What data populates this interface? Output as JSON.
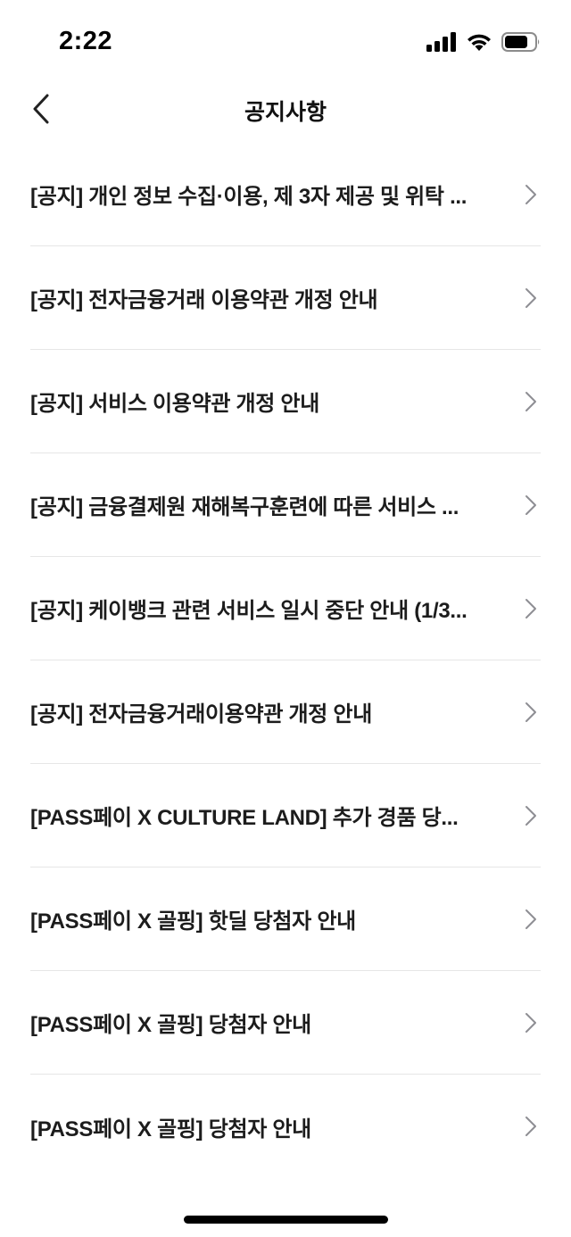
{
  "status_bar": {
    "time": "2:22"
  },
  "nav": {
    "title": "공지사항"
  },
  "notices": [
    {
      "title": "[공지] 개인 정보 수집·이용, 제 3자 제공 및 위탁 ..."
    },
    {
      "title": "[공지] 전자금융거래 이용약관 개정 안내"
    },
    {
      "title": "[공지] 서비스 이용약관 개정 안내"
    },
    {
      "title": "[공지] 금융결제원 재해복구훈련에 따른 서비스 ..."
    },
    {
      "title": "[공지] 케이뱅크 관련 서비스 일시 중단 안내 (1/3..."
    },
    {
      "title": "[공지] 전자금융거래이용약관 개정 안내"
    },
    {
      "title": "[PASS페이 X CULTURE LAND] 추가 경품 당..."
    },
    {
      "title": "[PASS페이 X 골핑] 핫딜 당첨자 안내"
    },
    {
      "title": "[PASS페이 X 골핑] 당첨자 안내"
    },
    {
      "title": "[PASS페이 X 골핑] 당첨자 안내"
    }
  ],
  "icons": {
    "back": "chevron-left-icon",
    "row_arrow": "chevron-right-icon",
    "signal": "cellular-signal-icon",
    "wifi": "wifi-icon",
    "battery": "battery-icon"
  },
  "colors": {
    "background": "#ffffff",
    "text": "#1c1c1c",
    "divider": "#e6e6e6",
    "chevron": "#8e8e93"
  }
}
